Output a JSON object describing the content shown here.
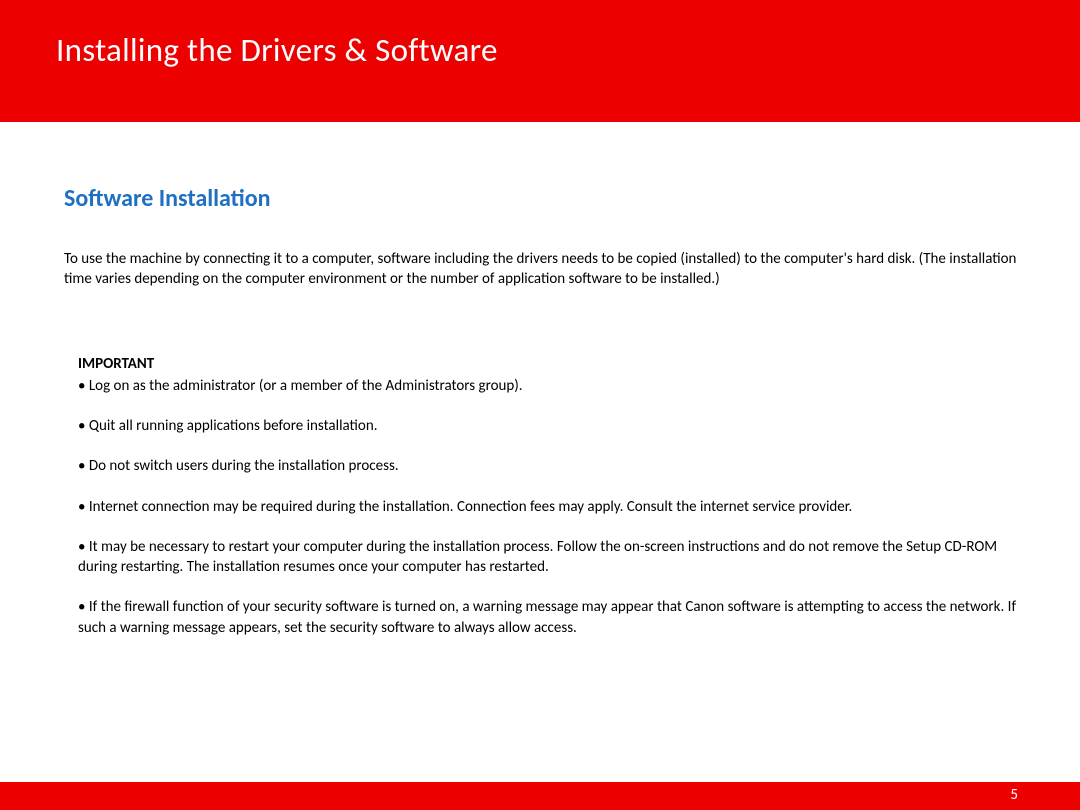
{
  "header": {
    "title": "Installing  the Drivers & Software"
  },
  "section": {
    "heading": "Software Installation",
    "intro": "To use the machine by connecting it to a computer, software including the drivers needs to be copied (installed) to the computer's hard disk. (The installation time varies depending on the computer environment or the number of application software to be installed.)"
  },
  "important": {
    "label": "IMPORTANT",
    "items": [
      "• Log on as the administrator (or a member of the Administrators group).",
      "• Quit all running applications before installation.",
      "• Do not switch users during the installation process.",
      "• Internet connection may be required during the installation. Connection fees may apply. Consult the internet service provider.",
      "• It may be necessary to restart your computer during the installation process. Follow the on-screen instructions and do not remove the Setup CD-ROM during restarting. The installation resumes once your computer has restarted.",
      "• If the firewall function of your security software is turned on, a warning message may appear that Canon software is attempting to access the network. If such a warning message appears, set the security software to always allow access."
    ]
  },
  "footer": {
    "page_number": "5"
  }
}
